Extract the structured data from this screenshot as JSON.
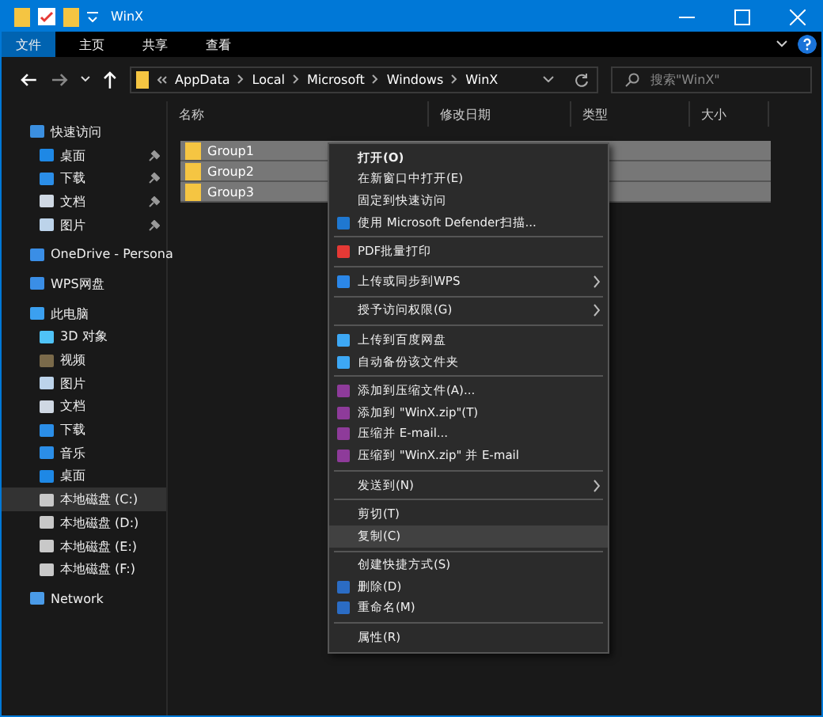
{
  "window": {
    "title": "WinX"
  },
  "ribbon_tabs": [
    {
      "label": "文件",
      "selected": true
    },
    {
      "label": "主页",
      "selected": false
    },
    {
      "label": "共享",
      "selected": false
    },
    {
      "label": "查看",
      "selected": false
    }
  ],
  "address_bar": {
    "path": [
      "AppData",
      "Local",
      "Microsoft",
      "Windows",
      "WinX"
    ]
  },
  "search": {
    "placeholder": "搜索\"WinX\""
  },
  "sidebar": {
    "items": [
      {
        "label": "快速访问",
        "kind": "star",
        "selected": false,
        "children": [
          {
            "label": "桌面",
            "kind": "desktop",
            "pinned": true,
            "selected": false
          },
          {
            "label": "下载",
            "kind": "download",
            "pinned": true,
            "selected": false
          },
          {
            "label": "文档",
            "kind": "document",
            "pinned": true,
            "selected": false
          },
          {
            "label": "图片",
            "kind": "picture",
            "pinned": true,
            "selected": false
          }
        ]
      },
      {
        "label": "OneDrive - Persona",
        "kind": "cloud",
        "selected": false
      },
      {
        "label": "WPS网盘",
        "kind": "cloud",
        "selected": false
      },
      {
        "label": "此电脑",
        "kind": "computer",
        "selected": false,
        "children": [
          {
            "label": "3D 对象",
            "kind": "cube",
            "selected": false
          },
          {
            "label": "视频",
            "kind": "video",
            "selected": false
          },
          {
            "label": "图片",
            "kind": "picture",
            "selected": false
          },
          {
            "label": "文档",
            "kind": "document",
            "selected": false
          },
          {
            "label": "下载",
            "kind": "download",
            "selected": false
          },
          {
            "label": "音乐",
            "kind": "music",
            "selected": false
          },
          {
            "label": "桌面",
            "kind": "desktop",
            "selected": false
          },
          {
            "label": "本地磁盘 (C:)",
            "kind": "drive",
            "selected": true
          },
          {
            "label": "本地磁盘 (D:)",
            "kind": "drive",
            "selected": false
          },
          {
            "label": "本地磁盘 (E:)",
            "kind": "drive",
            "selected": false
          },
          {
            "label": "本地磁盘 (F:)",
            "kind": "drive",
            "selected": false
          }
        ]
      },
      {
        "label": "Network",
        "kind": "network",
        "selected": false
      }
    ]
  },
  "table": {
    "columns": [
      "名称",
      "修改日期",
      "类型",
      "大小"
    ],
    "rows": [
      {
        "name": "Group1",
        "selected": true
      },
      {
        "name": "Group2",
        "selected": true
      },
      {
        "name": "Group3",
        "selected": true
      }
    ]
  },
  "context_menu": {
    "items": [
      {
        "kind": "plain",
        "label": "打开(O)",
        "bold": true,
        "submenu": false,
        "selected": false
      },
      {
        "kind": "plain",
        "label": "在新窗口中打开(E)",
        "bold": false,
        "submenu": false,
        "selected": false
      },
      {
        "kind": "plain",
        "label": "固定到快速访问",
        "bold": false,
        "submenu": false,
        "selected": false
      },
      {
        "kind": "defender",
        "label": "使用 Microsoft Defender扫描...",
        "bold": false,
        "submenu": false,
        "selected": false
      },
      {
        "kind": "separator"
      },
      {
        "kind": "wps",
        "label": "PDF批量打印",
        "bold": false,
        "submenu": false,
        "selected": false
      },
      {
        "kind": "separator"
      },
      {
        "kind": "upload",
        "label": "上传或同步到WPS",
        "bold": false,
        "submenu": true,
        "selected": false
      },
      {
        "kind": "separator"
      },
      {
        "kind": "plain",
        "label": "授予访问权限(G)",
        "bold": false,
        "submenu": true,
        "selected": false
      },
      {
        "kind": "separator"
      },
      {
        "kind": "baidu",
        "label": "上传到百度网盘",
        "bold": false,
        "submenu": false,
        "selected": false
      },
      {
        "kind": "baidu",
        "label": "自动备份该文件夹",
        "bold": false,
        "submenu": false,
        "selected": false
      },
      {
        "kind": "separator"
      },
      {
        "kind": "archive",
        "label": "添加到压缩文件(A)...",
        "bold": false,
        "submenu": false,
        "selected": false
      },
      {
        "kind": "archive",
        "label": "添加到 \"WinX.zip\"(T)",
        "bold": false,
        "submenu": false,
        "selected": false
      },
      {
        "kind": "archive",
        "label": "压缩并 E-mail...",
        "bold": false,
        "submenu": false,
        "selected": false
      },
      {
        "kind": "archive",
        "label": "压缩到 \"WinX.zip\" 并 E-mail",
        "bold": false,
        "submenu": false,
        "selected": false
      },
      {
        "kind": "separator"
      },
      {
        "kind": "plain",
        "label": "发送到(N)",
        "bold": false,
        "submenu": true,
        "selected": false
      },
      {
        "kind": "separator"
      },
      {
        "kind": "plain",
        "label": "剪切(T)",
        "bold": false,
        "submenu": false,
        "selected": false
      },
      {
        "kind": "plain",
        "label": "复制(C)",
        "bold": false,
        "submenu": false,
        "selected": true
      },
      {
        "kind": "separator"
      },
      {
        "kind": "plain",
        "label": "创建快捷方式(S)",
        "bold": false,
        "submenu": false,
        "selected": false
      },
      {
        "kind": "uac",
        "label": "删除(D)",
        "bold": false,
        "submenu": false,
        "selected": false
      },
      {
        "kind": "uac",
        "label": "重命名(M)",
        "bold": false,
        "submenu": false,
        "selected": false
      },
      {
        "kind": "separator"
      },
      {
        "kind": "plain",
        "label": "属性(R)",
        "bold": false,
        "submenu": false,
        "selected": false
      }
    ]
  }
}
